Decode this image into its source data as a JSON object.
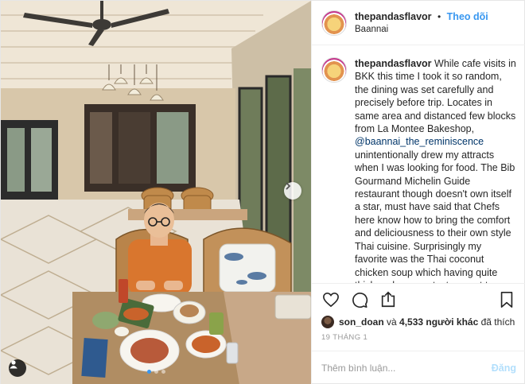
{
  "post": {
    "username": "thepandasflavor",
    "follow_label": "Theo dõi",
    "separator": "•",
    "location": "Baannai"
  },
  "caption": {
    "username": "thepandasflavor",
    "text_1": "While cafe visits in BKK this time I took it so random, the dining was set carefully and precisely before trip. Locates in same area and distanced few blocks from La Montee Bakeshop,",
    "mention": "@baannai_the_reminiscence",
    "text_2": "unintentionally drew my attracts when I was looking for food. The Bib Gourmand Michelin Guide restaurant though doesn't own itself a star, must have said that Chefs here know how to bring the comfort and deliciousness to their own style Thai cuisine. Surprisingly my favorite was the Thai coconut chicken soup which having quite thick and creamy texture, not too spicy so I did enjoy every single bite. Besides, the traditional rice cake had a long-last gently comfi level of"
  },
  "actions": {
    "icons": [
      "heart-icon",
      "comment-icon",
      "share-icon",
      "bookmark-icon"
    ]
  },
  "likes": {
    "user": "son_doan",
    "connector": " và ",
    "count_text": "4,533 người khác",
    "suffix": " đã thích"
  },
  "date": "19 THÁNG 1",
  "comment": {
    "placeholder": "Thêm bình luận...",
    "post_label": "Đăng"
  },
  "carousel": {
    "slides": 3,
    "current": 1
  },
  "colors": {
    "accent": "#3897f0",
    "post_disabled": "#b2dffc",
    "border": "#efefef"
  }
}
